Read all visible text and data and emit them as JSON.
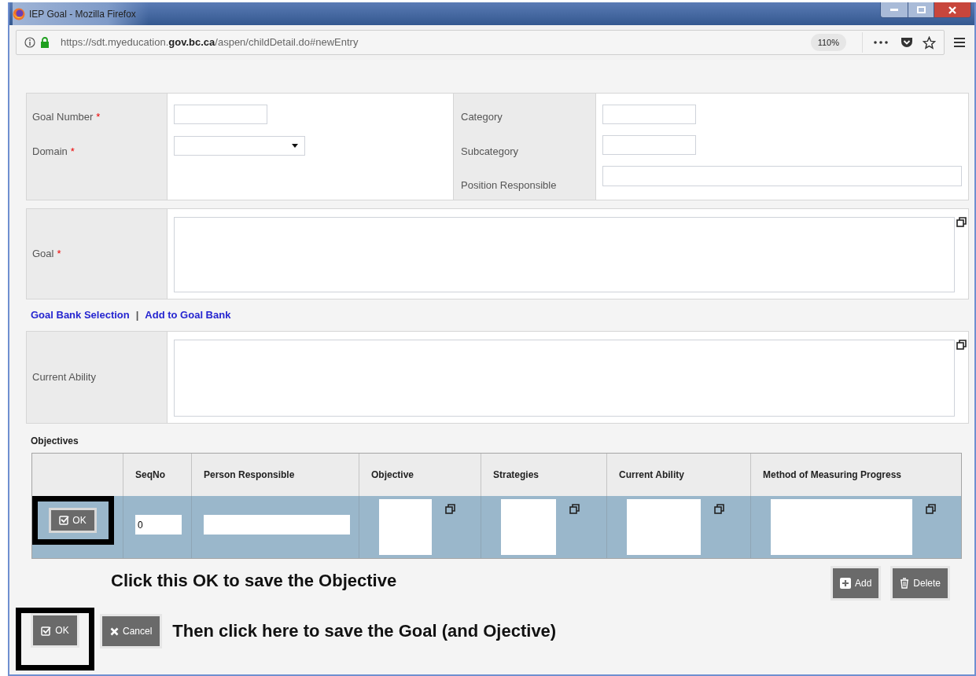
{
  "window": {
    "title": "IEP Goal - Mozilla Firefox"
  },
  "address_bar": {
    "url": "https://sdt.myeducation.**gov.bc.ca**/aspen/childDetail.do#newEntry",
    "zoom": "110%"
  },
  "form": {
    "left_fields": [
      {
        "label": "Goal Number",
        "required_mark": "*",
        "kind": "text"
      },
      {
        "label": "Domain",
        "required_mark": "*",
        "kind": "select"
      }
    ],
    "right_fields": [
      {
        "label": "Category",
        "kind": "text"
      },
      {
        "label": "Subcategory",
        "kind": "text"
      },
      {
        "label": "Position Responsible",
        "kind": "wide"
      }
    ],
    "goal": {
      "label": "Goal",
      "required_mark": "*"
    },
    "links": [
      {
        "label": "Goal Bank Selection"
      },
      {
        "label": "Add to Goal Bank"
      }
    ],
    "link_separator": "|",
    "current_ability": {
      "label": "Current Ability"
    }
  },
  "objectives": {
    "title": "Objectives",
    "columns": [
      "SeqNo",
      "Person Responsible",
      "Objective",
      "Strategies",
      "Current Ability",
      "Method of Measuring Progress"
    ],
    "row": {
      "ok_label": "OK",
      "highlighted": true,
      "cells": [
        {
          "kind": "input",
          "value": "0"
        },
        {
          "kind": "input"
        },
        {
          "kind": "textarea"
        },
        {
          "kind": "textarea"
        },
        {
          "kind": "textarea"
        },
        {
          "kind": "textarea_wide"
        }
      ]
    },
    "buttons": [
      {
        "label": "Add",
        "kind": "add"
      },
      {
        "label": "Delete",
        "kind": "delete"
      }
    ]
  },
  "annotations": {
    "row_ok": "Click this OK to save the Objective",
    "footer": "Then click here to save the Goal (and Ojective)"
  },
  "footer_buttons": [
    {
      "label": "OK",
      "kind": "ok",
      "highlighted": true
    },
    {
      "label": "Cancel",
      "kind": "cancel",
      "highlighted": false
    }
  ]
}
